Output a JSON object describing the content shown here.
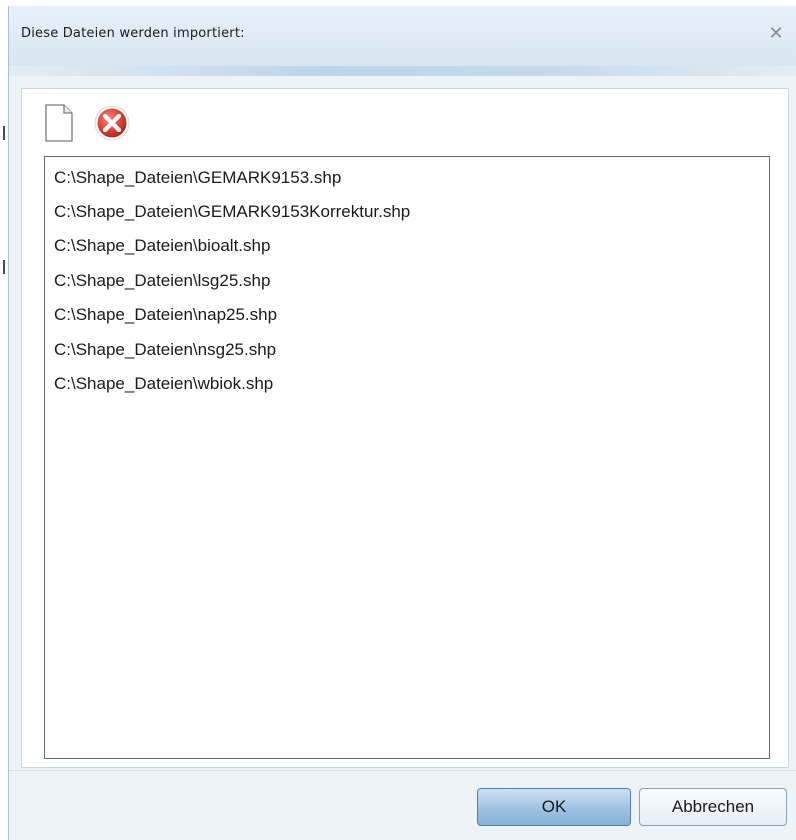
{
  "dialog": {
    "title": "Diese Dateien werden importiert:",
    "close_icon": "close-icon"
  },
  "toolbar": {
    "add_icon": "new-file-icon",
    "remove_icon": "remove-icon"
  },
  "files": [
    "C:\\Shape_Dateien\\GEMARK9153.shp",
    "C:\\Shape_Dateien\\GEMARK9153Korrektur.shp",
    "C:\\Shape_Dateien\\bioalt.shp",
    "C:\\Shape_Dateien\\lsg25.shp",
    "C:\\Shape_Dateien\\nap25.shp",
    "C:\\Shape_Dateien\\nsg25.shp",
    "C:\\Shape_Dateien\\wbiok.shp"
  ],
  "buttons": {
    "ok_label": "OK",
    "cancel_label": "Abbrechen"
  },
  "colors": {
    "title_bg": "#dbe8f3",
    "ok_accent": "#9ec2e3",
    "remove_red": "#e0453a"
  }
}
